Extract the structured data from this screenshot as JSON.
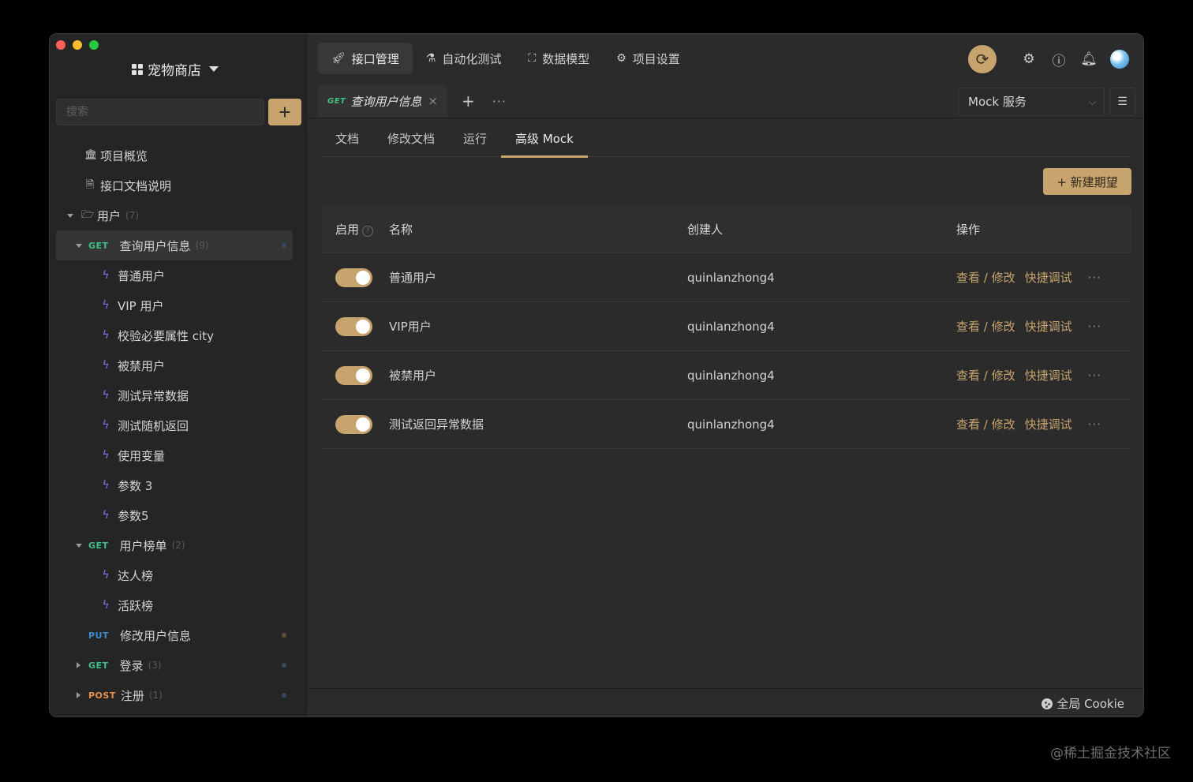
{
  "project": {
    "name": "宠物商店"
  },
  "search": {
    "placeholder": "搜索"
  },
  "sidebar": {
    "items": [
      {
        "label": "项目概览"
      },
      {
        "label": "接口文档说明"
      },
      {
        "label": "用户",
        "count": "(7)"
      },
      {
        "method": "GET",
        "label": "查询用户信息",
        "count": "(9)"
      },
      {
        "label": "普通用户"
      },
      {
        "label": "VIP 用户"
      },
      {
        "label": "校验必要属性 city"
      },
      {
        "label": "被禁用户"
      },
      {
        "label": "测试异常数据"
      },
      {
        "label": "测试随机返回"
      },
      {
        "label": "使用变量"
      },
      {
        "label": "参数 3"
      },
      {
        "label": "参数5"
      },
      {
        "method": "GET",
        "label": "用户榜单",
        "count": "(2)"
      },
      {
        "label": "达人榜"
      },
      {
        "label": "活跃榜"
      },
      {
        "method": "PUT",
        "label": "修改用户信息"
      },
      {
        "method": "GET",
        "label": "登录",
        "count": "(3)"
      },
      {
        "method": "POST",
        "label": "注册",
        "count": "(1)"
      }
    ]
  },
  "topnav": {
    "tabs": [
      {
        "label": "接口管理"
      },
      {
        "label": "自动化测试"
      },
      {
        "label": "数据模型"
      },
      {
        "label": "项目设置"
      }
    ]
  },
  "filetab": {
    "method": "GET",
    "label": "查询用户信息",
    "close": "×",
    "plus": "+",
    "more": "···"
  },
  "mock_service": {
    "label": "Mock 服务"
  },
  "subtabs": [
    {
      "label": "文档"
    },
    {
      "label": "修改文档"
    },
    {
      "label": "运行"
    },
    {
      "label": "高级 Mock"
    }
  ],
  "new_expectation": {
    "label": "+ 新建期望"
  },
  "table": {
    "headers": {
      "enabled": "启用",
      "name": "名称",
      "creator": "创建人",
      "actions": "操作"
    },
    "view_edit": "查看 / 修改",
    "quick_debug": "快捷调试",
    "more": "···",
    "rows": [
      {
        "name": "普通用户",
        "creator": "quinlanzhong4",
        "enabled": true
      },
      {
        "name": "VIP用户",
        "creator": "quinlanzhong4",
        "enabled": true
      },
      {
        "name": "被禁用户",
        "creator": "quinlanzhong4",
        "enabled": true
      },
      {
        "name": "测试返回异常数据",
        "creator": "quinlanzhong4",
        "enabled": true
      }
    ]
  },
  "footer": {
    "cookie": "全局 Cookie"
  },
  "watermark": "@稀土掘金技术社区",
  "colors": {
    "accent": "#c7a46e",
    "get": "#3dc187",
    "put": "#3a8bd6",
    "post": "#e9904c",
    "bolt": "#8d6be6"
  }
}
